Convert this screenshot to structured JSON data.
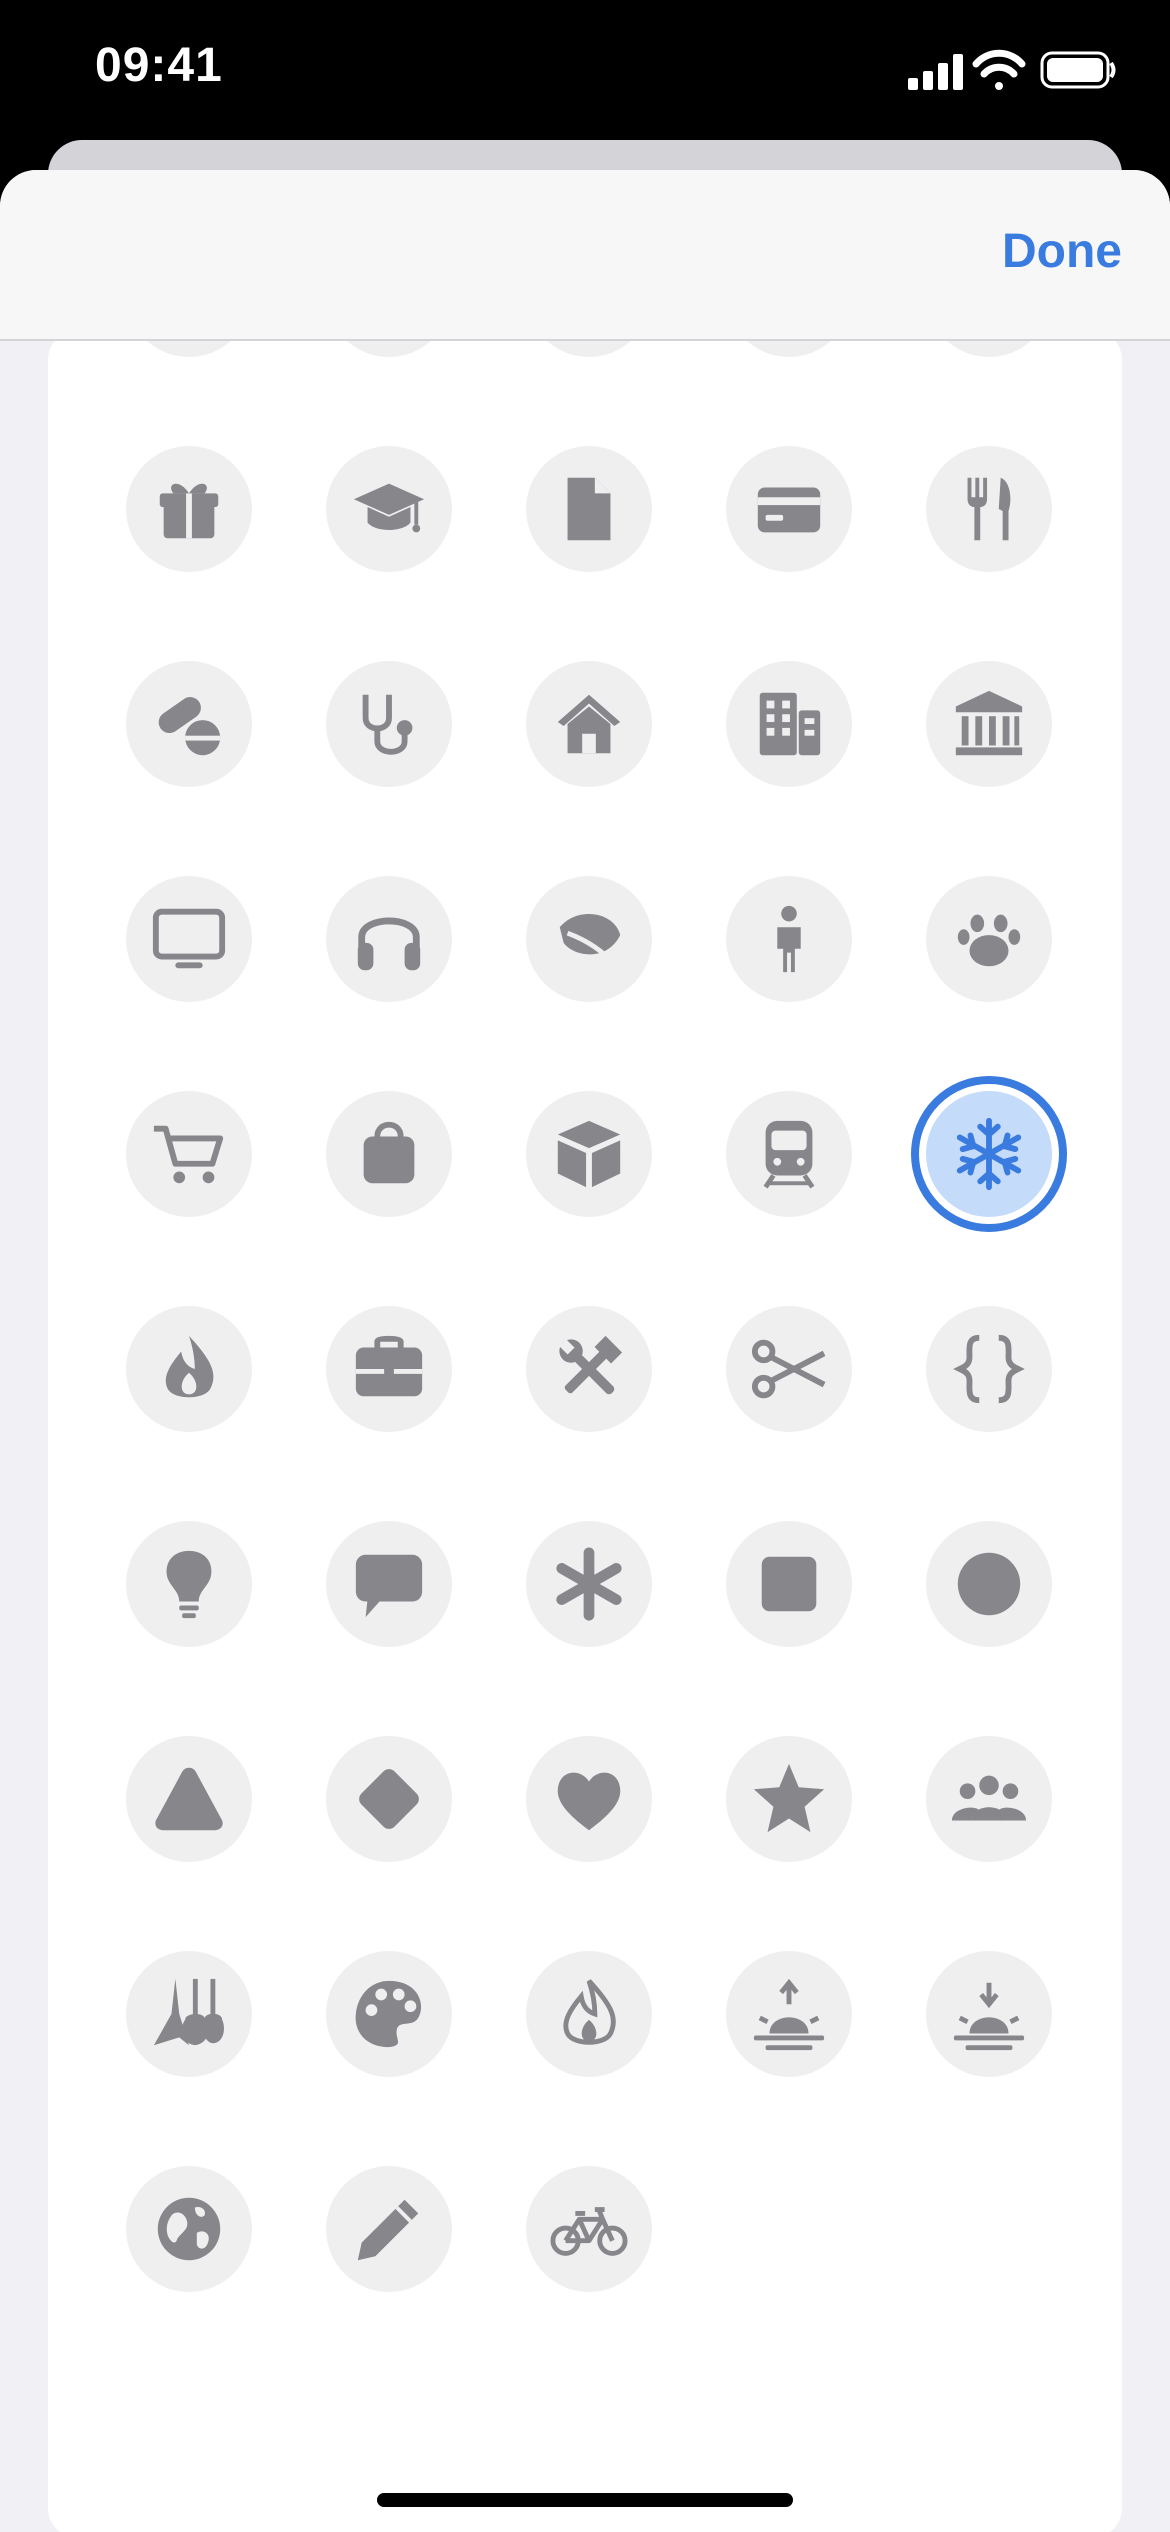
{
  "status_bar": {
    "time": "09:41"
  },
  "nav": {
    "done_label": "Done"
  },
  "colors": {
    "accent": "#3a7be0",
    "icon_gray": "#86868b",
    "selected_fill": "#c5dbfa"
  },
  "icon_grid": {
    "selected_icon": "snowflake-icon",
    "rows": [
      [
        "gift-icon",
        "graduation-cap-icon",
        "document-icon",
        "credit-card-icon",
        "fork-knife-icon"
      ],
      [
        "pills-icon",
        "stethoscope-icon",
        "house-icon",
        "building-icon",
        "bank-icon"
      ],
      [
        "display-icon",
        "headphones-icon",
        "leaf-icon",
        "person-icon",
        "paw-icon"
      ],
      [
        "cart-icon",
        "bag-icon",
        "shipping-box-icon",
        "tram-icon",
        "snowflake-icon"
      ],
      [
        "flame-drop-icon",
        "briefcase-icon",
        "tools-icon",
        "scissors-icon",
        "curly-braces-icon"
      ],
      [
        "lightbulb-icon",
        "speech-bubble-icon",
        "asterisk-icon",
        "square-icon",
        "circle-icon"
      ],
      [
        "triangle-icon",
        "diamond-icon",
        "heart-icon",
        "star-icon",
        "group-icon"
      ],
      [
        "guitars-icon",
        "palette-icon",
        "flame-icon",
        "sunrise-icon",
        "sunset-icon"
      ],
      [
        "globe-icon",
        "pencil-icon",
        "bicycle-icon"
      ]
    ]
  }
}
